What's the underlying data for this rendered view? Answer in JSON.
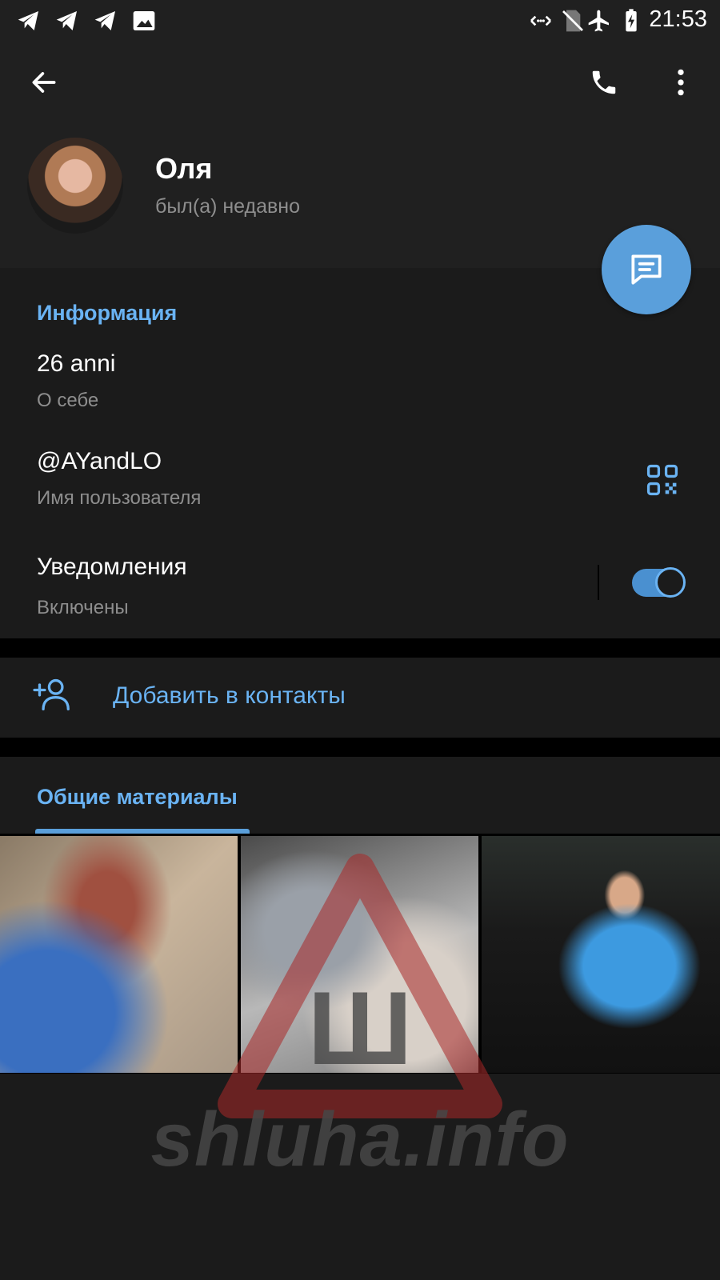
{
  "status_bar": {
    "time": "21:53",
    "left_icons": [
      "telegram-icon",
      "telegram-icon",
      "telegram-icon",
      "image-icon"
    ],
    "right_icons": [
      "data-saver-icon",
      "no-sim-icon",
      "airplane-icon",
      "battery-charging-icon"
    ]
  },
  "toolbar": {
    "icons": [
      "back-arrow-icon",
      "phone-icon",
      "more-vert-icon"
    ]
  },
  "profile": {
    "name": "Оля",
    "last_seen": "был(а) недавно"
  },
  "info": {
    "section_title": "Информация",
    "bio_value": "26 anni",
    "bio_label": "О себе",
    "username_value": "@AYandLO",
    "username_label": "Имя пользователя",
    "notifications_value": "Уведомления",
    "notifications_label": "Включены",
    "notifications_enabled": true
  },
  "actions": {
    "add_contact": "Добавить в контакты"
  },
  "media": {
    "tab_title": "Общие материалы"
  },
  "watermark": {
    "text": "shluha.info",
    "glyph": "Ш"
  },
  "colors": {
    "accent": "#6ab3f3",
    "fab": "#5a9fdb",
    "background": "#1b1b1b",
    "header": "#202020"
  }
}
